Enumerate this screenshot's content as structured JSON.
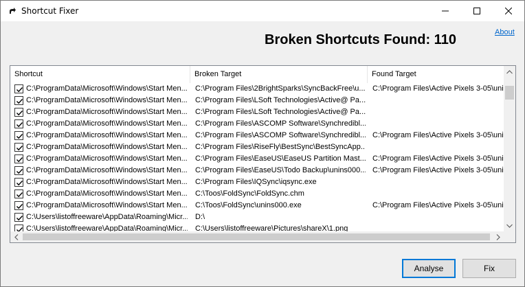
{
  "window": {
    "title": "Shortcut Fixer",
    "app_icon": "shortcut-arrow-icon"
  },
  "heading": {
    "label": "Broken Shortcuts Found:",
    "count": "110"
  },
  "about_link": "About",
  "columns": [
    "Shortcut",
    "Broken Target",
    "Found Target"
  ],
  "rows": [
    {
      "checked": true,
      "shortcut": "C:\\ProgramData\\Microsoft\\Windows\\Start Men...",
      "broken": "C:\\Program Files\\2BrightSparks\\SyncBackFree\\u...",
      "found": "C:\\Program Files\\Active Pixels 3-05\\uni..."
    },
    {
      "checked": true,
      "shortcut": "C:\\ProgramData\\Microsoft\\Windows\\Start Men...",
      "broken": "C:\\Program Files\\LSoft Technologies\\Active@ Pa...",
      "found": ""
    },
    {
      "checked": true,
      "shortcut": "C:\\ProgramData\\Microsoft\\Windows\\Start Men...",
      "broken": "C:\\Program Files\\LSoft Technologies\\Active@ Pa...",
      "found": ""
    },
    {
      "checked": true,
      "shortcut": "C:\\ProgramData\\Microsoft\\Windows\\Start Men...",
      "broken": "C:\\Program Files\\ASCOMP Software\\Synchredibl...",
      "found": ""
    },
    {
      "checked": true,
      "shortcut": "C:\\ProgramData\\Microsoft\\Windows\\Start Men...",
      "broken": "C:\\Program Files\\ASCOMP Software\\Synchredibl...",
      "found": "C:\\Program Files\\Active Pixels 3-05\\uni..."
    },
    {
      "checked": true,
      "shortcut": "C:\\ProgramData\\Microsoft\\Windows\\Start Men...",
      "broken": "C:\\Program Files\\RiseFly\\BestSync\\BestSyncApp...",
      "found": ""
    },
    {
      "checked": true,
      "shortcut": "C:\\ProgramData\\Microsoft\\Windows\\Start Men...",
      "broken": "C:\\Program Files\\EaseUS\\EaseUS Partition Mast...",
      "found": "C:\\Program Files\\Active Pixels 3-05\\uni..."
    },
    {
      "checked": true,
      "shortcut": "C:\\ProgramData\\Microsoft\\Windows\\Start Men...",
      "broken": "C:\\Program Files\\EaseUS\\Todo Backup\\unins000....",
      "found": "C:\\Program Files\\Active Pixels 3-05\\uni..."
    },
    {
      "checked": true,
      "shortcut": "C:\\ProgramData\\Microsoft\\Windows\\Start Men...",
      "broken": "C:\\Program Files\\IQSync\\iqsync.exe",
      "found": ""
    },
    {
      "checked": true,
      "shortcut": "C:\\ProgramData\\Microsoft\\Windows\\Start Men...",
      "broken": "C:\\Toos\\FoldSync\\FoldSync.chm",
      "found": ""
    },
    {
      "checked": true,
      "shortcut": "C:\\ProgramData\\Microsoft\\Windows\\Start Men...",
      "broken": "C:\\Toos\\FoldSync\\unins000.exe",
      "found": "C:\\Program Files\\Active Pixels 3-05\\uni..."
    },
    {
      "checked": true,
      "shortcut": "C:\\Users\\listoffreeware\\AppData\\Roaming\\Micr...",
      "broken": "D:\\",
      "found": ""
    },
    {
      "checked": true,
      "shortcut": "C:\\Users\\listoffreeware\\AppData\\Roaming\\Micr...",
      "broken": "C:\\Users\\listoffreeware\\Pictures\\shareX\\1.png",
      "found": ""
    }
  ],
  "buttons": {
    "analyse": "Analyse",
    "fix": "Fix"
  }
}
